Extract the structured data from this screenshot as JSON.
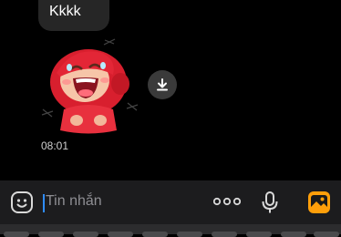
{
  "chat": {
    "incoming_bubble_text": "Kkkk",
    "sticker_icon": "laughing-girl-sticker-icon",
    "download_icon": "download-icon",
    "timestamp": "08:01"
  },
  "input_bar": {
    "emoji_icon": "sticker-face-icon",
    "placeholder": "Tin nhắn",
    "more_icon": "more-dots-icon",
    "mic_icon": "microphone-icon",
    "image_icon": "image-gallery-icon"
  },
  "colors": {
    "background": "#000000",
    "bubble": "#262626",
    "input_bar": "#1c1c1e",
    "caret": "#2f8cff",
    "image_icon_accent": "#ff9f0a"
  }
}
